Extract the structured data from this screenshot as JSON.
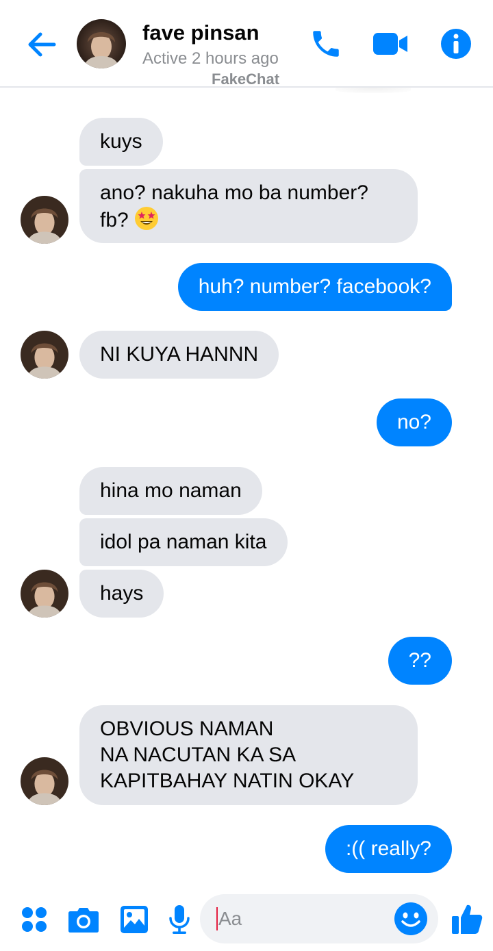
{
  "header": {
    "contact_name": "fave pinsan",
    "status": "Active 2 hours ago",
    "watermark": "FakeChat"
  },
  "messages": [
    {
      "from": "them",
      "text": "kuys"
    },
    {
      "from": "them",
      "text": "ano? nakuha mo ba number?",
      "text2": "fb?",
      "emoji": "star-struck-emoji"
    },
    {
      "from": "me",
      "text": "huh? number? facebook?"
    },
    {
      "from": "them",
      "text": "NI KUYA HANNN"
    },
    {
      "from": "me",
      "text": "no?"
    },
    {
      "from": "them",
      "text": "hina mo naman"
    },
    {
      "from": "them",
      "text": "idol pa naman kita"
    },
    {
      "from": "them",
      "text": "hays"
    },
    {
      "from": "me",
      "text": "??"
    },
    {
      "from": "them",
      "lines": [
        "OBVIOUS NAMAN",
        "NA NACUTAN KA SA",
        "KAPITBAHAY NATIN OKAY"
      ]
    },
    {
      "from": "me",
      "text": ":(( really?"
    }
  ],
  "composer": {
    "placeholder": "Aa"
  },
  "icons": [
    "back-arrow-icon",
    "phone-icon",
    "video-camera-icon",
    "info-icon",
    "apps-grid-icon",
    "camera-icon",
    "image-icon",
    "microphone-icon",
    "smiley-icon",
    "thumbs-up-icon"
  ],
  "colors": {
    "accent": "#0084ff",
    "received_bubble": "#e4e6eb",
    "muted_text": "#8a8d91",
    "caret": "#e41e3f"
  }
}
